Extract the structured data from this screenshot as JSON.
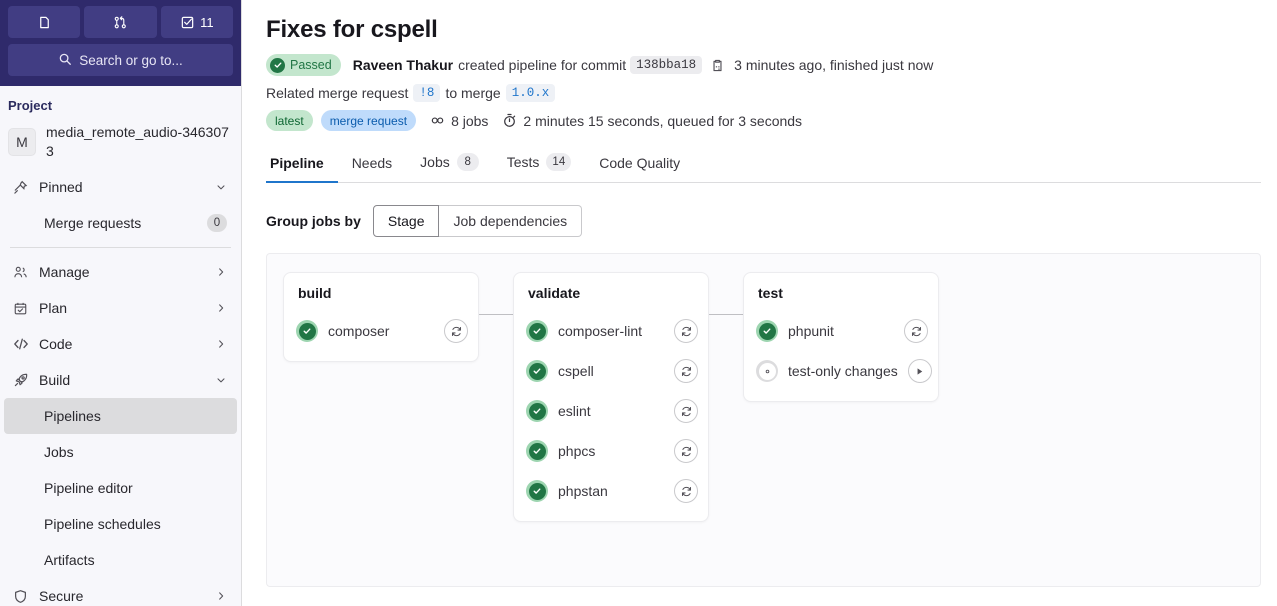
{
  "topbar": {
    "buttons": [
      {
        "name": "issues-icon",
        "label": ""
      },
      {
        "name": "merge-requests-icon",
        "label": ""
      },
      {
        "name": "todos-icon",
        "label": "11"
      }
    ],
    "search_placeholder": "Search or go to..."
  },
  "sidebar": {
    "section_title": "Project",
    "project": {
      "initial": "M",
      "name": "media_remote_audio-3463073"
    },
    "items": [
      {
        "label": "Pinned",
        "icon": "pin-icon",
        "chevron": "down",
        "badge": null,
        "sub": false,
        "active": false
      },
      {
        "label": "Merge requests",
        "icon": null,
        "chevron": null,
        "badge": "0",
        "sub": true,
        "active": false
      },
      {
        "label": "Manage",
        "icon": "users-icon",
        "chevron": "right",
        "badge": null,
        "sub": false,
        "active": false
      },
      {
        "label": "Plan",
        "icon": "calendar-icon",
        "chevron": "right",
        "badge": null,
        "sub": false,
        "active": false
      },
      {
        "label": "Code",
        "icon": "code-icon",
        "chevron": "right",
        "badge": null,
        "sub": false,
        "active": false
      },
      {
        "label": "Build",
        "icon": "rocket-icon",
        "chevron": "down",
        "badge": null,
        "sub": false,
        "active": false
      },
      {
        "label": "Pipelines",
        "icon": null,
        "chevron": null,
        "badge": null,
        "sub": true,
        "active": true
      },
      {
        "label": "Jobs",
        "icon": null,
        "chevron": null,
        "badge": null,
        "sub": true,
        "active": false
      },
      {
        "label": "Pipeline editor",
        "icon": null,
        "chevron": null,
        "badge": null,
        "sub": true,
        "active": false
      },
      {
        "label": "Pipeline schedules",
        "icon": null,
        "chevron": null,
        "badge": null,
        "sub": true,
        "active": false
      },
      {
        "label": "Artifacts",
        "icon": null,
        "chevron": null,
        "badge": null,
        "sub": true,
        "active": false
      },
      {
        "label": "Secure",
        "icon": "shield-icon",
        "chevron": "right",
        "badge": null,
        "sub": false,
        "active": false
      }
    ]
  },
  "header": {
    "title": "Fixes for cspell",
    "status_label": "Passed",
    "author": "Raveen Thakur",
    "action_text": "created pipeline for commit",
    "commit_sha": "138bba18",
    "time_text": "3 minutes ago, finished just now",
    "mr_prefix": "Related merge request",
    "mr_ref": "!8",
    "mr_middle": "to merge",
    "mr_target": "1.0.x",
    "tag_latest": "latest",
    "tag_merge_request": "merge request",
    "jobs_count_text": "8 jobs",
    "duration_text": "2 minutes 15 seconds, queued for 3 seconds"
  },
  "tabs": [
    {
      "label": "Pipeline",
      "count": null,
      "active": true
    },
    {
      "label": "Needs",
      "count": null,
      "active": false
    },
    {
      "label": "Jobs",
      "count": "8",
      "active": false
    },
    {
      "label": "Tests",
      "count": "14",
      "active": false
    },
    {
      "label": "Code Quality",
      "count": null,
      "active": false
    }
  ],
  "group_jobs": {
    "label": "Group jobs by",
    "options": [
      {
        "label": "Stage",
        "active": true
      },
      {
        "label": "Job dependencies",
        "active": false
      }
    ]
  },
  "pipeline": {
    "stages": [
      {
        "name": "build",
        "jobs": [
          {
            "name": "composer",
            "status": "success",
            "action": "retry-icon"
          }
        ]
      },
      {
        "name": "validate",
        "jobs": [
          {
            "name": "composer-lint",
            "status": "success",
            "action": "retry-icon"
          },
          {
            "name": "cspell",
            "status": "success",
            "action": "retry-icon"
          },
          {
            "name": "eslint",
            "status": "success",
            "action": "retry-icon"
          },
          {
            "name": "phpcs",
            "status": "success",
            "action": "retry-icon"
          },
          {
            "name": "phpstan",
            "status": "success",
            "action": "retry-icon"
          }
        ]
      },
      {
        "name": "test",
        "jobs": [
          {
            "name": "phpunit",
            "status": "success",
            "action": "retry-icon"
          },
          {
            "name": "test-only changes",
            "status": "manual",
            "action": "play-icon"
          }
        ]
      }
    ]
  },
  "colors": {
    "brand_navy": "#2f2a6b",
    "success_green": "#217645",
    "success_bg": "#c3e6cd",
    "link_blue": "#1f75cb",
    "mr_badge_bg": "#bfdbfb"
  }
}
